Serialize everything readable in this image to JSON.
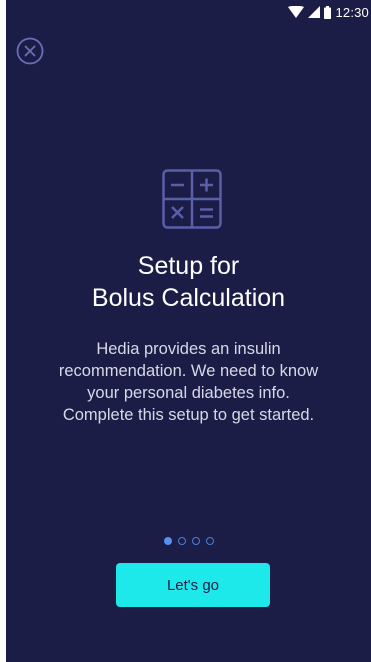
{
  "status_bar": {
    "time": "12:30",
    "icons": [
      "wifi-icon",
      "cell-signal-icon",
      "battery-icon"
    ]
  },
  "close_button": {
    "icon": "close-circle-icon"
  },
  "illustration": {
    "icon": "calculator-icon"
  },
  "title": {
    "line1": "Setup for",
    "line2": "Bolus Calculation"
  },
  "description": "Hedia provides an insulin recommendation. We need to know your personal diabetes info. Complete this setup to get started.",
  "pager": {
    "total": 4,
    "active_index": 0
  },
  "cta": {
    "label": "Let's go"
  },
  "colors": {
    "background": "#1c1d47",
    "accent": "#1de8ea",
    "icon_stroke": "#5a5fa8",
    "dot_active": "#5b8ff0"
  }
}
